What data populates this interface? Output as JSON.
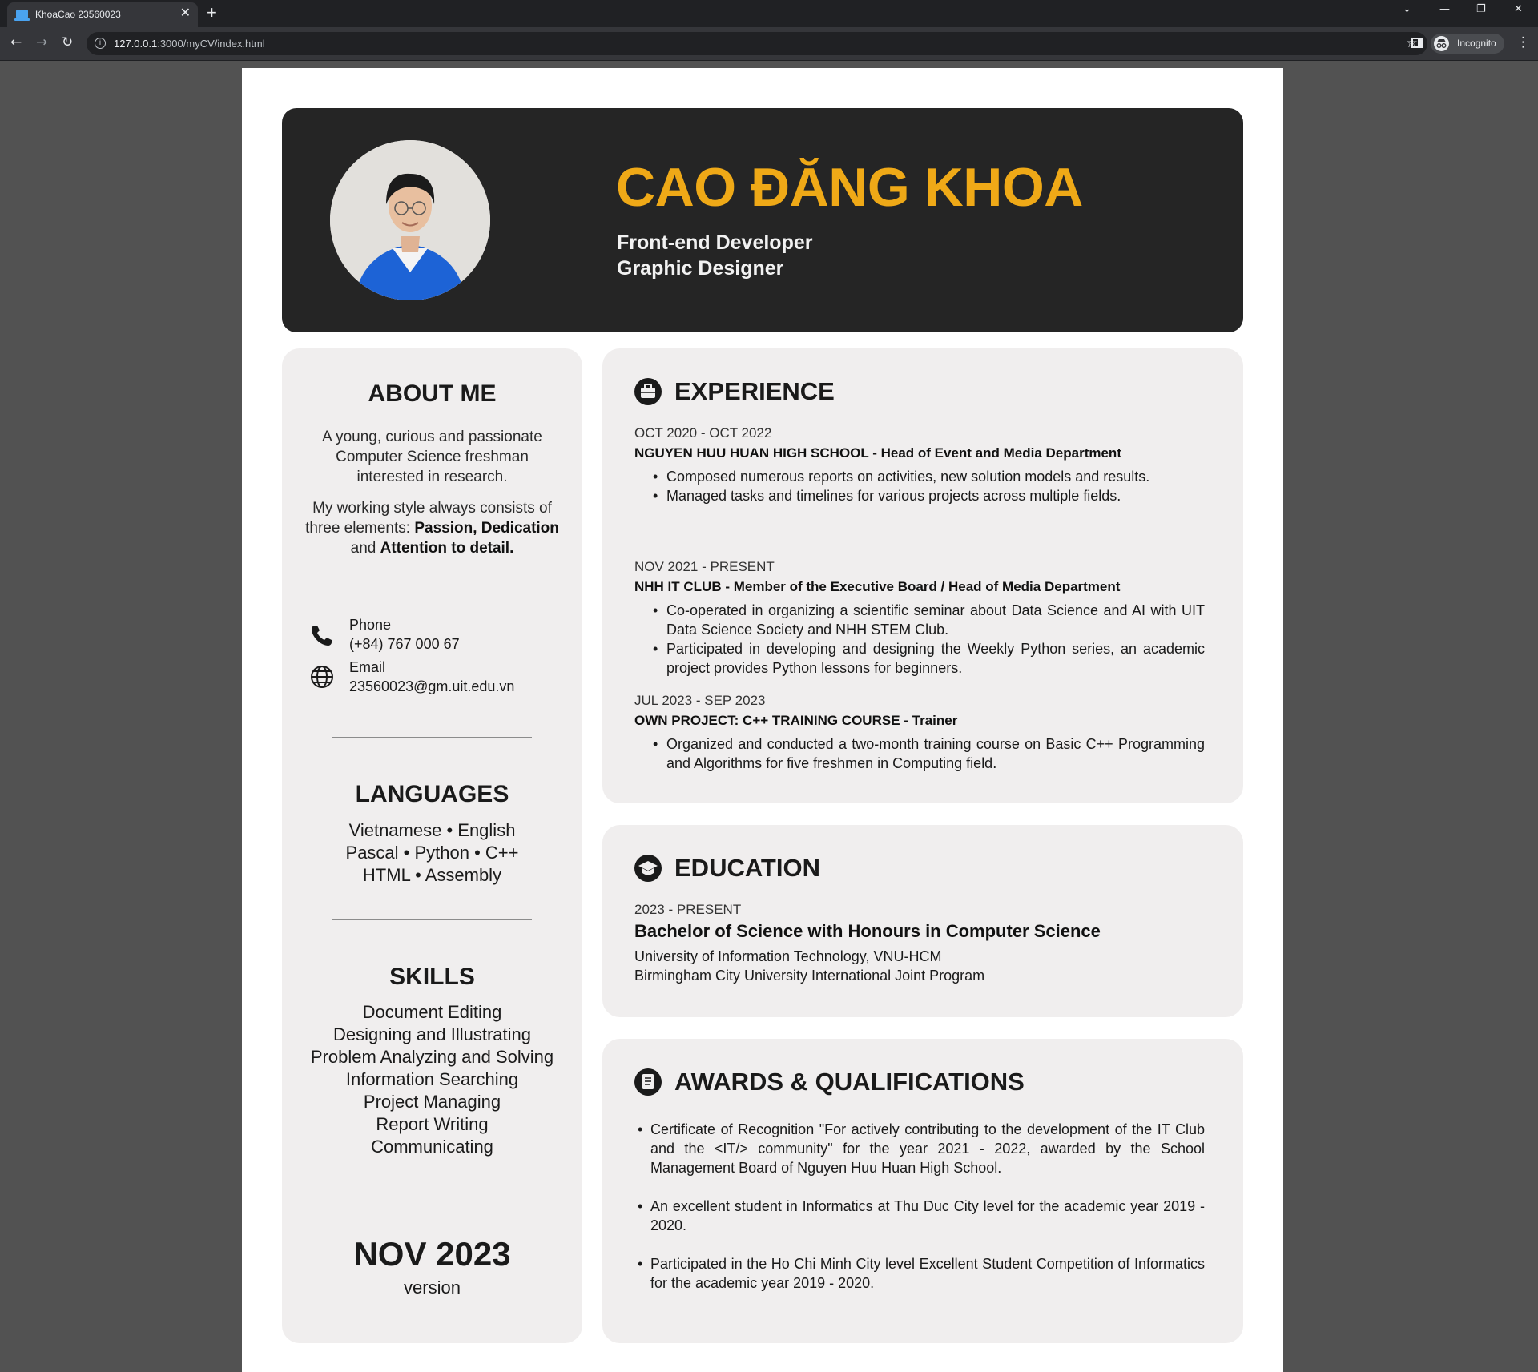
{
  "browser": {
    "tab_title": "KhoaCao 23560023",
    "tab_close": "✕",
    "new_tab": "+",
    "url_host": "127.0.0.1",
    "url_path": ":3000/myCV/index.html",
    "profile_label": "Incognito"
  },
  "header": {
    "name": "CAO ĐĂNG KHOA",
    "roles": [
      "Front-end Developer",
      "Graphic Designer"
    ]
  },
  "sidebar": {
    "about_title": "ABOUT ME",
    "about_text": "A young, curious and passionate Computer Science freshman interested in research.",
    "style_prefix": "My working style always consists of three elements: ",
    "style_passion": "Passion, Dedication",
    "style_and": " and ",
    "style_attention": "Attention to detail.",
    "phone_label": "Phone",
    "phone_value": "(+84) 767 000 67",
    "email_label": "Email",
    "email_value": "23560023@gm.uit.edu.vn",
    "languages_title": "LANGUAGES",
    "languages": [
      "Vietnamese • English",
      "Pascal • Python • C++",
      "HTML • Assembly"
    ],
    "skills_title": "SKILLS",
    "skills": [
      "Document Editing",
      "Designing and Illustrating",
      "Problem Analyzing and Solving",
      "Information Searching",
      "Project Managing",
      "Report Writing",
      "Communicating"
    ],
    "version_date": "NOV 2023",
    "version_label": "version"
  },
  "experience": {
    "title": "EXPERIENCE",
    "items": [
      {
        "date": "OCT 2020 - OCT 2022",
        "org": "NGUYEN HUU HUAN HIGH SCHOOL - Head of Event and Media Department",
        "bullets": [
          "Composed numerous reports on activities, new solution models and results.",
          "Managed tasks and timelines for various projects across multiple fields."
        ]
      },
      {
        "date": "NOV 2021 - PRESENT",
        "org": "NHH IT CLUB - Member of the Executive Board / Head of Media Department",
        "bullets": [
          "Co-operated in organizing a scientific seminar about Data Science and AI with UIT Data Science Society and NHH STEM Club.",
          "Participated in developing and designing the Weekly Python series, an academic project provides Python lessons for beginners."
        ]
      },
      {
        "date": "JUL 2023 - SEP 2023",
        "org": "OWN PROJECT: C++ TRAINING COURSE - Trainer",
        "bullets": [
          "Organized and conducted a two-month training course on Basic C++ Programming and Algorithms for five freshmen in Computing field."
        ]
      }
    ]
  },
  "education": {
    "title": "EDUCATION",
    "date": "2023 - PRESENT",
    "degree": "Bachelor of Science with Honours in Computer Science",
    "school": "University of Information Technology, VNU-HCM",
    "program": "Birmingham City University International Joint Program"
  },
  "awards": {
    "title": "AWARDS & QUALIFICATIONS",
    "items": [
      "Certificate of Recognition \"For actively contributing to the development of the IT Club and the <IT/> community\" for the year 2021 - 2022, awarded by the School Management Board of Nguyen Huu Huan High School.",
      "An excellent student in Informatics at Thu Duc City level for the academic year 2019 - 2020.",
      "Participated in the Ho Chi Minh City level Excellent Student Competition of Informatics for the academic year 2019 - 2020."
    ]
  },
  "colors": {
    "accent": "#efa917",
    "header_bg": "#252525",
    "card_bg": "#f0eeee",
    "page_bg": "#525252"
  }
}
